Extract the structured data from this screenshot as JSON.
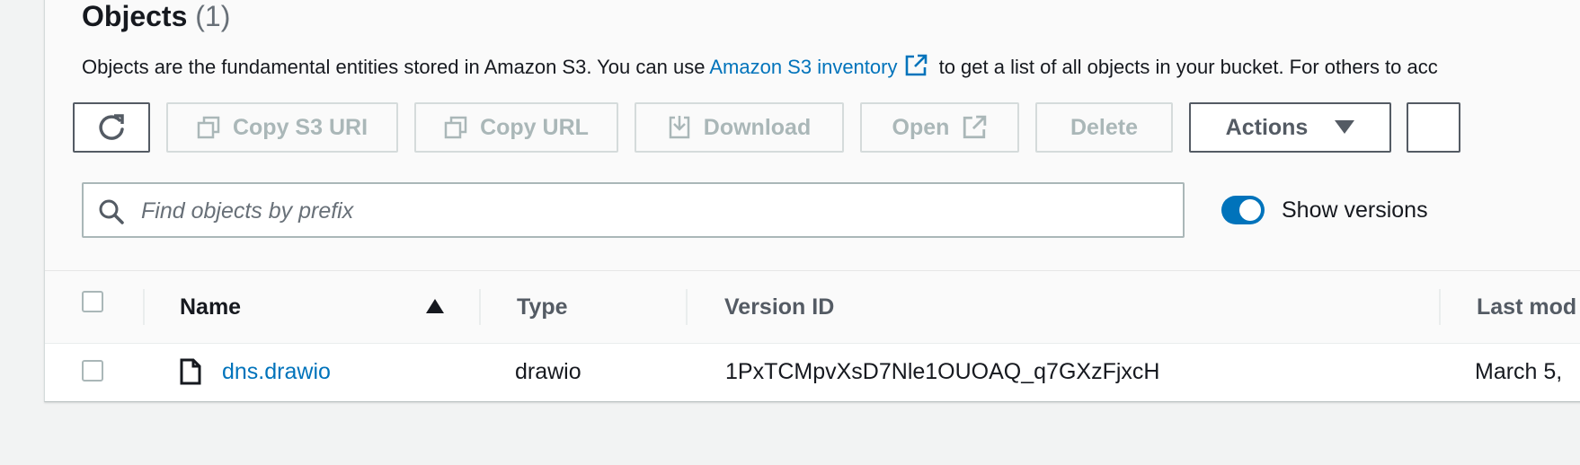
{
  "objects": {
    "title": "Objects",
    "count": "(1)",
    "description_before": "Objects are the fundamental entities stored in Amazon S3. You can use",
    "description_link": "Amazon S3 inventory",
    "description_after": "to get a list of all objects in your bucket. For others to acc"
  },
  "toolbar": {
    "refresh_icon": "refresh-icon",
    "copy_s3_uri": "Copy S3 URI",
    "copy_url": "Copy URL",
    "download": "Download",
    "open": "Open",
    "delete": "Delete",
    "actions": "Actions"
  },
  "search": {
    "placeholder": "Find objects by prefix",
    "value": ""
  },
  "versions_toggle": {
    "label": "Show versions",
    "enabled": true
  },
  "table": {
    "columns": [
      "Name",
      "Type",
      "Version ID",
      "Last mod"
    ],
    "sort_column": "Name",
    "sort_direction": "ascending",
    "rows": [
      {
        "name": "dns.drawio",
        "type": "drawio",
        "version_id": "1PxTCMpvXsD7Nle1OUOAQ_q7GXzFjxcH",
        "last_modified": "March 5,"
      }
    ]
  },
  "colors": {
    "link": "#0073bb",
    "toggle_on": "#0073bb",
    "disabled_text": "#aab7b8",
    "text": "#16191f"
  }
}
